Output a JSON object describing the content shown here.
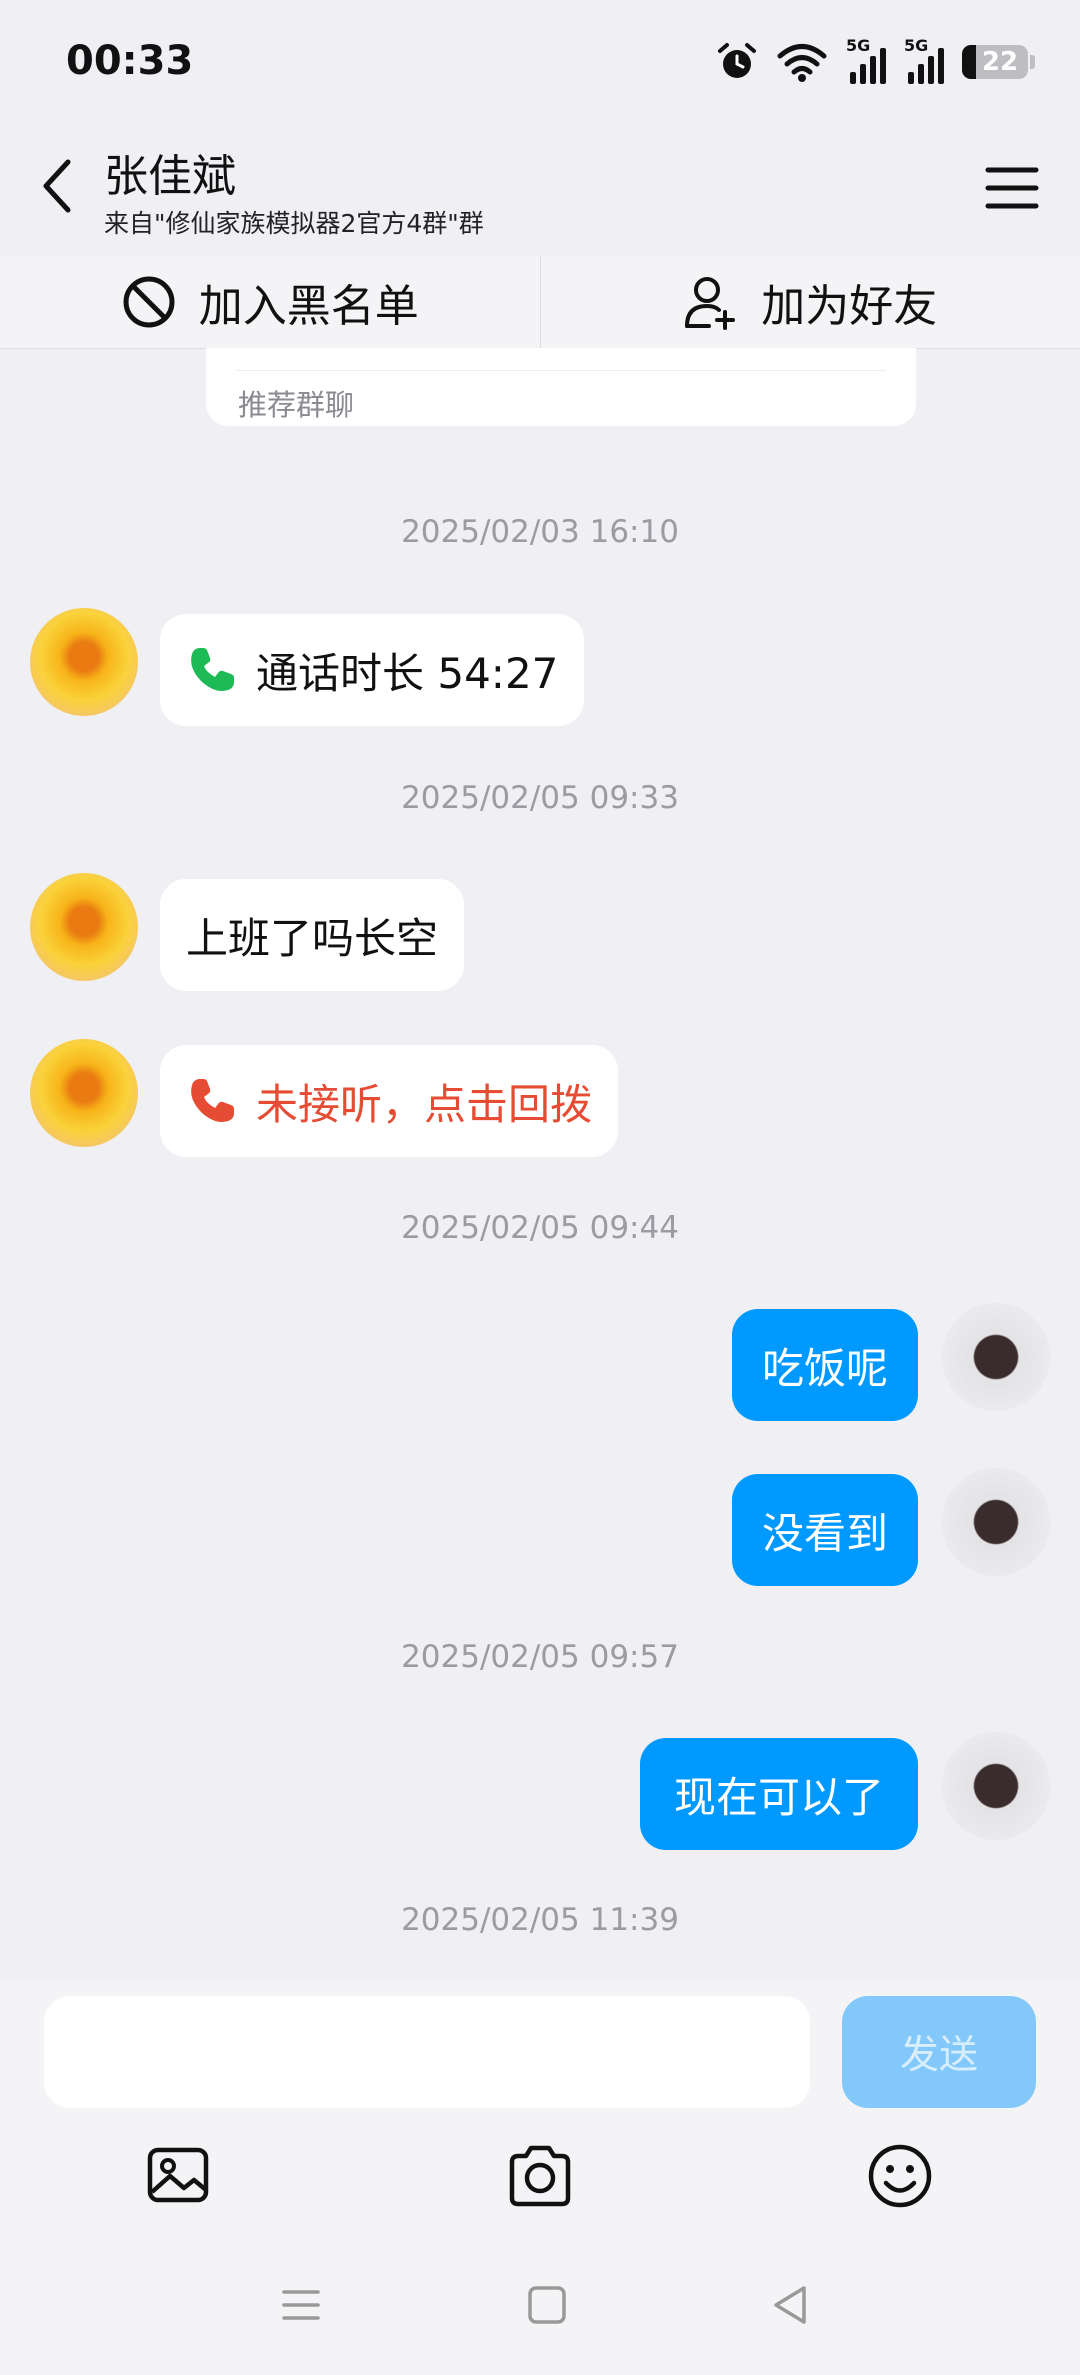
{
  "status_bar": {
    "time": "00:33",
    "signal_label_1": "5G",
    "signal_label_2": "5G",
    "battery": "22",
    "icons": [
      "alarm-icon",
      "wifi-icon",
      "signal-icon",
      "signal-icon",
      "battery-icon"
    ]
  },
  "header": {
    "name": "张佳斌",
    "subtitle": "来自\"修仙家族模拟器2官方4群\"群"
  },
  "actions": {
    "block_label": "加入黑名单",
    "add_friend_label": "加为好友"
  },
  "recommend_card": {
    "label": "推荐群聊"
  },
  "messages": {
    "ts1": "2025/02/03 16:10",
    "call_duration": "通话时长 54:27",
    "ts2": "2025/02/05 09:33",
    "msg_work": "上班了吗长空",
    "missed_call": "未接听，点击回拨",
    "ts3": "2025/02/05 09:44",
    "msg_eating": "吃饭呢",
    "msg_didnt_see": "没看到",
    "ts4": "2025/02/05 09:57",
    "msg_now_ok": "现在可以了",
    "ts5": "2025/02/05 11:39"
  },
  "composer": {
    "input_value": "",
    "send_label": "发送"
  },
  "colors": {
    "background": "#efeff4",
    "self_bubble": "#0099ff",
    "call_green": "#1dba55",
    "missed_red": "#e64c34",
    "send_disabled": "#82c8fb"
  }
}
